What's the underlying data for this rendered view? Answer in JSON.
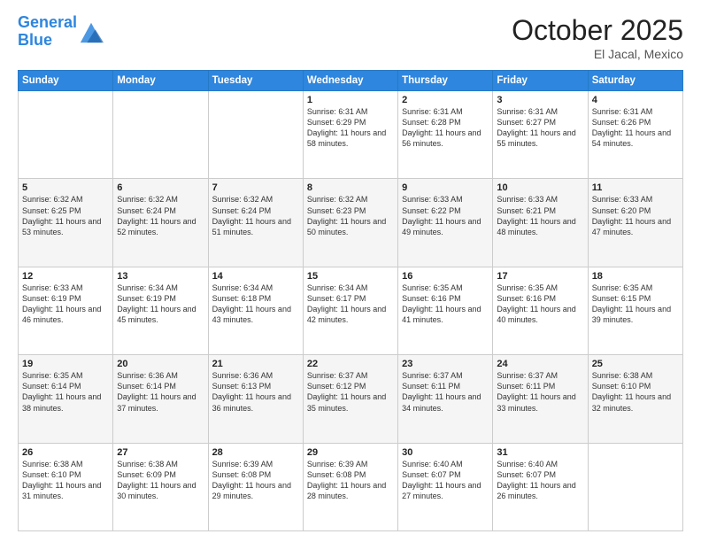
{
  "header": {
    "logo_line1": "General",
    "logo_line2": "Blue",
    "month": "October 2025",
    "location": "El Jacal, Mexico"
  },
  "days_of_week": [
    "Sunday",
    "Monday",
    "Tuesday",
    "Wednesday",
    "Thursday",
    "Friday",
    "Saturday"
  ],
  "weeks": [
    [
      {
        "day": "",
        "info": ""
      },
      {
        "day": "",
        "info": ""
      },
      {
        "day": "",
        "info": ""
      },
      {
        "day": "1",
        "info": "Sunrise: 6:31 AM\nSunset: 6:29 PM\nDaylight: 11 hours and 58 minutes."
      },
      {
        "day": "2",
        "info": "Sunrise: 6:31 AM\nSunset: 6:28 PM\nDaylight: 11 hours and 56 minutes."
      },
      {
        "day": "3",
        "info": "Sunrise: 6:31 AM\nSunset: 6:27 PM\nDaylight: 11 hours and 55 minutes."
      },
      {
        "day": "4",
        "info": "Sunrise: 6:31 AM\nSunset: 6:26 PM\nDaylight: 11 hours and 54 minutes."
      }
    ],
    [
      {
        "day": "5",
        "info": "Sunrise: 6:32 AM\nSunset: 6:25 PM\nDaylight: 11 hours and 53 minutes."
      },
      {
        "day": "6",
        "info": "Sunrise: 6:32 AM\nSunset: 6:24 PM\nDaylight: 11 hours and 52 minutes."
      },
      {
        "day": "7",
        "info": "Sunrise: 6:32 AM\nSunset: 6:24 PM\nDaylight: 11 hours and 51 minutes."
      },
      {
        "day": "8",
        "info": "Sunrise: 6:32 AM\nSunset: 6:23 PM\nDaylight: 11 hours and 50 minutes."
      },
      {
        "day": "9",
        "info": "Sunrise: 6:33 AM\nSunset: 6:22 PM\nDaylight: 11 hours and 49 minutes."
      },
      {
        "day": "10",
        "info": "Sunrise: 6:33 AM\nSunset: 6:21 PM\nDaylight: 11 hours and 48 minutes."
      },
      {
        "day": "11",
        "info": "Sunrise: 6:33 AM\nSunset: 6:20 PM\nDaylight: 11 hours and 47 minutes."
      }
    ],
    [
      {
        "day": "12",
        "info": "Sunrise: 6:33 AM\nSunset: 6:19 PM\nDaylight: 11 hours and 46 minutes."
      },
      {
        "day": "13",
        "info": "Sunrise: 6:34 AM\nSunset: 6:19 PM\nDaylight: 11 hours and 45 minutes."
      },
      {
        "day": "14",
        "info": "Sunrise: 6:34 AM\nSunset: 6:18 PM\nDaylight: 11 hours and 43 minutes."
      },
      {
        "day": "15",
        "info": "Sunrise: 6:34 AM\nSunset: 6:17 PM\nDaylight: 11 hours and 42 minutes."
      },
      {
        "day": "16",
        "info": "Sunrise: 6:35 AM\nSunset: 6:16 PM\nDaylight: 11 hours and 41 minutes."
      },
      {
        "day": "17",
        "info": "Sunrise: 6:35 AM\nSunset: 6:16 PM\nDaylight: 11 hours and 40 minutes."
      },
      {
        "day": "18",
        "info": "Sunrise: 6:35 AM\nSunset: 6:15 PM\nDaylight: 11 hours and 39 minutes."
      }
    ],
    [
      {
        "day": "19",
        "info": "Sunrise: 6:35 AM\nSunset: 6:14 PM\nDaylight: 11 hours and 38 minutes."
      },
      {
        "day": "20",
        "info": "Sunrise: 6:36 AM\nSunset: 6:14 PM\nDaylight: 11 hours and 37 minutes."
      },
      {
        "day": "21",
        "info": "Sunrise: 6:36 AM\nSunset: 6:13 PM\nDaylight: 11 hours and 36 minutes."
      },
      {
        "day": "22",
        "info": "Sunrise: 6:37 AM\nSunset: 6:12 PM\nDaylight: 11 hours and 35 minutes."
      },
      {
        "day": "23",
        "info": "Sunrise: 6:37 AM\nSunset: 6:11 PM\nDaylight: 11 hours and 34 minutes."
      },
      {
        "day": "24",
        "info": "Sunrise: 6:37 AM\nSunset: 6:11 PM\nDaylight: 11 hours and 33 minutes."
      },
      {
        "day": "25",
        "info": "Sunrise: 6:38 AM\nSunset: 6:10 PM\nDaylight: 11 hours and 32 minutes."
      }
    ],
    [
      {
        "day": "26",
        "info": "Sunrise: 6:38 AM\nSunset: 6:10 PM\nDaylight: 11 hours and 31 minutes."
      },
      {
        "day": "27",
        "info": "Sunrise: 6:38 AM\nSunset: 6:09 PM\nDaylight: 11 hours and 30 minutes."
      },
      {
        "day": "28",
        "info": "Sunrise: 6:39 AM\nSunset: 6:08 PM\nDaylight: 11 hours and 29 minutes."
      },
      {
        "day": "29",
        "info": "Sunrise: 6:39 AM\nSunset: 6:08 PM\nDaylight: 11 hours and 28 minutes."
      },
      {
        "day": "30",
        "info": "Sunrise: 6:40 AM\nSunset: 6:07 PM\nDaylight: 11 hours and 27 minutes."
      },
      {
        "day": "31",
        "info": "Sunrise: 6:40 AM\nSunset: 6:07 PM\nDaylight: 11 hours and 26 minutes."
      },
      {
        "day": "",
        "info": ""
      }
    ]
  ]
}
